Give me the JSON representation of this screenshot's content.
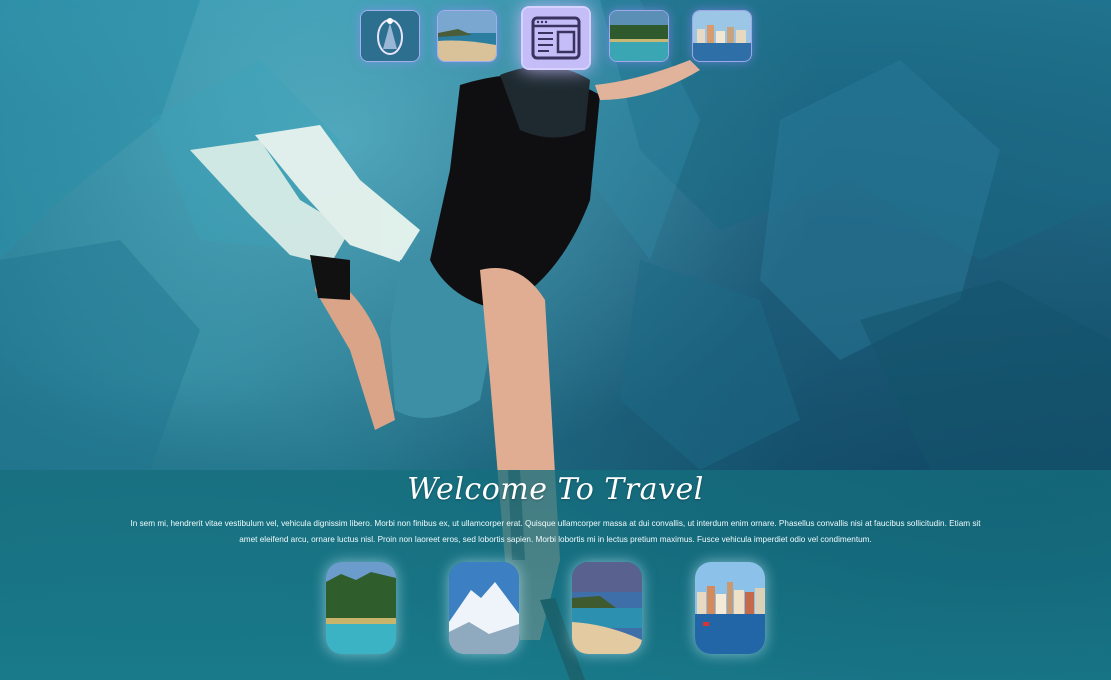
{
  "hero": {
    "title": "Welcome To Travel",
    "body": "In sem mi, hendrerit vitae vestibulum vel, vehicula dignissim libero. Morbi non finibus ex, ut ullamcorper erat. Quisque ullamcorper massa at dui convallis, ut interdum enim ornare. Phasellus convallis nisi at faucibus sollicitudin. Etiam sit amet eleifend arcu, ornare luctus nisl. Proin non laoreet eros, sed lobortis sapien. Morbi lobortis mi in lectus pretium maximus. Fusce vehicula imperdiet odio vel condimentum."
  },
  "top_nav": {
    "items": [
      {
        "icon": "ornament-thumbnail",
        "active": false
      },
      {
        "icon": "beach-thumbnail",
        "active": false
      },
      {
        "icon": "layout-window-icon",
        "active": true
      },
      {
        "icon": "lake-forest-thumbnail",
        "active": false
      },
      {
        "icon": "harbor-town-thumbnail",
        "active": false
      }
    ]
  },
  "gallery": {
    "items": [
      {
        "icon": "lake-forest-thumbnail"
      },
      {
        "icon": "snowy-mountain-thumbnail"
      },
      {
        "icon": "beach-cliff-thumbnail"
      },
      {
        "icon": "harbor-town-thumbnail"
      }
    ]
  },
  "colors": {
    "accent": "#c9c3ff",
    "band": "#1a7a8c",
    "text": "#ffffff"
  }
}
